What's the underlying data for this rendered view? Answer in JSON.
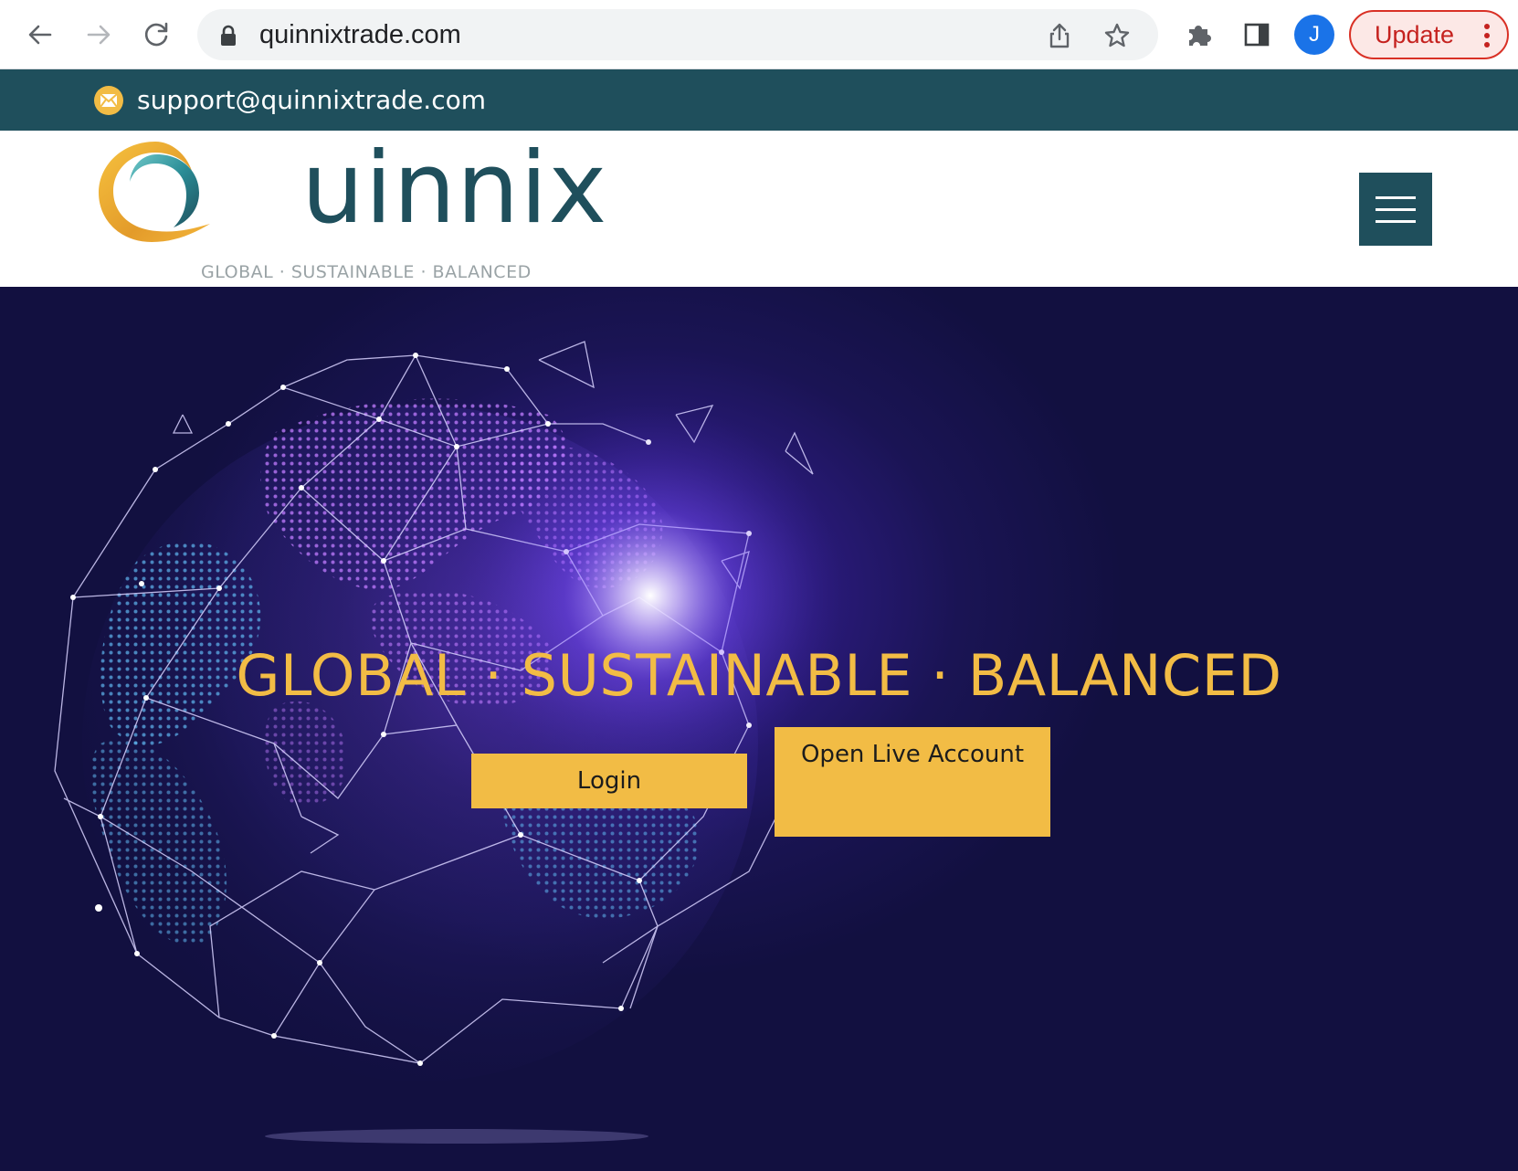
{
  "browser": {
    "url": "quinnixtrade.com",
    "avatar_letter": "J",
    "update_label": "Update"
  },
  "support": {
    "email": "support@quinnixtrade.com"
  },
  "header": {
    "logo_word": "uinnix",
    "tagline": "GLOBAL · SUSTAINABLE · BALANCED"
  },
  "hero": {
    "title": "GLOBAL · SUSTAINABLE · BALANCED",
    "login_label": "Login",
    "open_account_label": "Open Live Account"
  },
  "colors": {
    "brand_teal": "#1f4f5c",
    "accent_gold": "#f2bc45",
    "hero_bg": "#1a1454"
  }
}
